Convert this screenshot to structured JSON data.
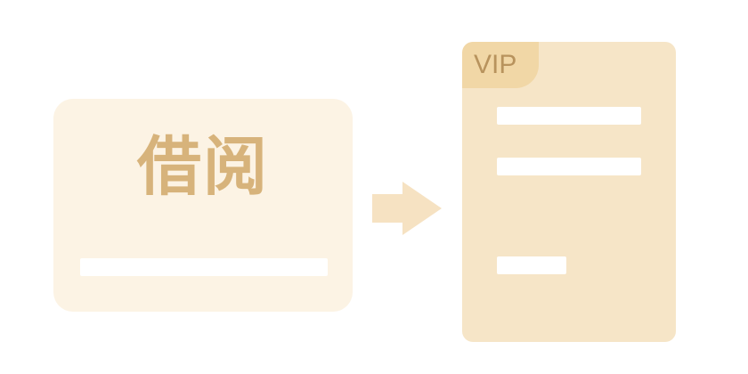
{
  "borrow_card": {
    "title": "借阅"
  },
  "vip_document": {
    "badge_label": "VIP"
  },
  "arrow": {
    "icon": "arrow-right-icon"
  },
  "colors": {
    "borrow_card_bg": "#fcf3e4",
    "borrow_title": "#d7b37b",
    "vip_doc_bg": "#f6e5c7",
    "vip_badge_bg": "#f1d7a6",
    "vip_badge_text": "#b8935d",
    "arrow": "#f6e2c2",
    "placeholder_line": "#ffffff"
  }
}
